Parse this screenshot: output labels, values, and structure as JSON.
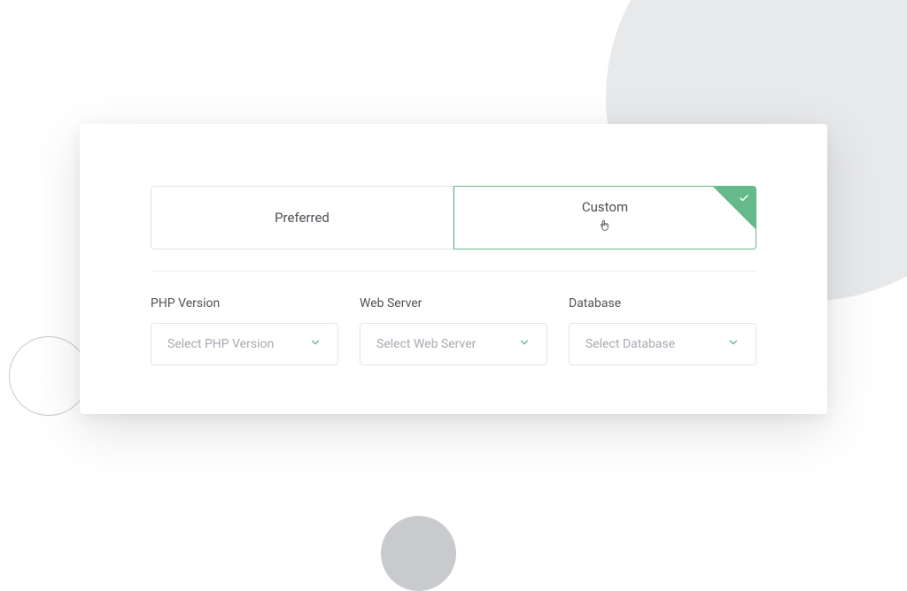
{
  "tabs": {
    "preferred": {
      "label": "Preferred"
    },
    "custom": {
      "label": "Custom",
      "selected": true
    }
  },
  "fields": {
    "php": {
      "label": "PHP Version",
      "placeholder": "Select PHP Version"
    },
    "web": {
      "label": "Web Server",
      "placeholder": "Select Web Server"
    },
    "database": {
      "label": "Database",
      "placeholder": "Select Database"
    }
  },
  "colors": {
    "accent": "#66b98a",
    "border": "#e2e3e7",
    "textMuted": "#a6aab2"
  }
}
